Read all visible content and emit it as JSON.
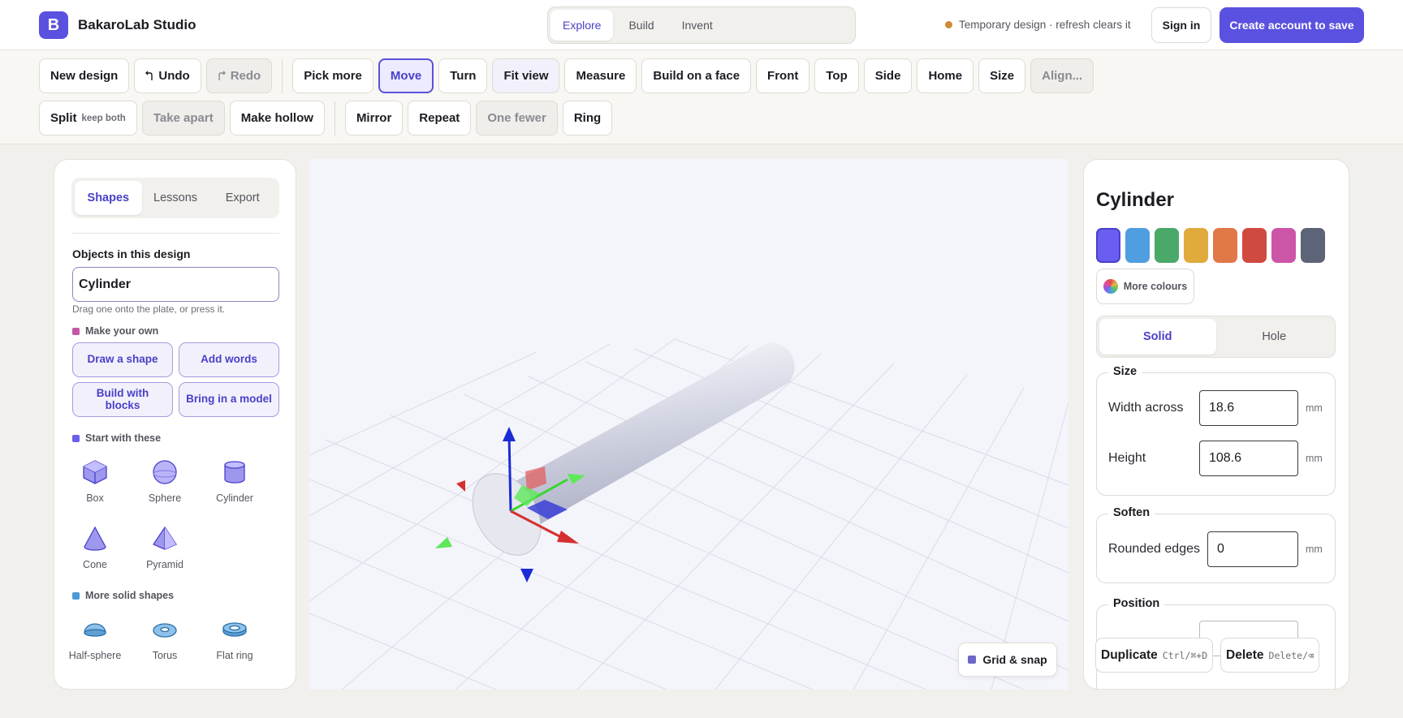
{
  "app": {
    "logo_letter": "B",
    "name": "BakaroLab Studio",
    "modes": [
      "Explore",
      "Build",
      "Invent"
    ],
    "active_mode": "Explore",
    "temp_note": "Temporary design · refresh clears it",
    "sign_in": "Sign in",
    "create_account": "Create account to save",
    "accent_color": "#5b51e0"
  },
  "toolbar": {
    "row1": [
      {
        "label": "New design"
      },
      {
        "label": "Undo",
        "icon": "undo-icon"
      },
      {
        "label": "Redo",
        "icon": "redo-icon",
        "state": "disabled"
      },
      {
        "label": "Pick more"
      },
      {
        "label": "Move",
        "state": "active"
      },
      {
        "label": "Turn"
      },
      {
        "label": "Fit view",
        "state": "soft"
      },
      {
        "label": "Measure"
      },
      {
        "label": "Build on a face"
      },
      {
        "label": "Front"
      },
      {
        "label": "Top"
      },
      {
        "label": "Side"
      },
      {
        "label": "Home"
      },
      {
        "label": "Size"
      },
      {
        "label": "Align...",
        "state": "disabled"
      }
    ],
    "row2": [
      {
        "label": "Split",
        "hint": "keep both"
      },
      {
        "label": "Take apart",
        "state": "disabled"
      },
      {
        "label": "Make hollow"
      },
      {
        "label": "Mirror"
      },
      {
        "label": "Repeat"
      },
      {
        "label": "One fewer",
        "state": "disabled"
      },
      {
        "label": "Ring"
      }
    ]
  },
  "left_panel": {
    "tabs": [
      "Shapes",
      "Lessons",
      "Export"
    ],
    "active_tab": "Shapes",
    "objects_title": "Objects in this design",
    "object_value": "Cylinder",
    "object_hint": "Drag one onto the plate, or press it.",
    "make_own_title": "Make your own",
    "make_own_buttons": [
      "Draw a shape",
      "Add words",
      "Build with blocks",
      "Bring in a model"
    ],
    "start_title": "Start with these",
    "start_shapes": [
      {
        "label": "Box",
        "icon": "box-icon"
      },
      {
        "label": "Sphere",
        "icon": "sphere-icon"
      },
      {
        "label": "Cylinder",
        "icon": "cylinder-icon"
      },
      {
        "label": "Cone",
        "icon": "cone-icon"
      },
      {
        "label": "Pyramid",
        "icon": "pyramid-icon"
      }
    ],
    "more_title": "More solid shapes",
    "more_shapes": [
      {
        "label": "Half-sphere",
        "icon": "half-sphere-icon"
      },
      {
        "label": "Torus",
        "icon": "torus-icon"
      },
      {
        "label": "Flat ring",
        "icon": "flat-ring-icon"
      }
    ],
    "colors": {
      "make_own": "#c457a4",
      "start": "#6a5ee8",
      "more": "#4b9ad8"
    }
  },
  "viewport": {
    "grid_snap": "Grid & snap"
  },
  "right_panel": {
    "title": "Cylinder",
    "swatches": [
      "#6a5ef0",
      "#4f9ee0",
      "#4aa868",
      "#e0aa3c",
      "#e07848",
      "#d04a40",
      "#cc55a8",
      "#5d6478"
    ],
    "more_colours": "More colours",
    "modes": [
      "Solid",
      "Hole"
    ],
    "active_mode": "Solid",
    "size_title": "Size",
    "width_label": "Width across",
    "width_value": "18.6",
    "height_label": "Height",
    "height_value": "108.6",
    "unit": "mm",
    "soften_title": "Soften",
    "rounded_label": "Rounded edges",
    "rounded_value": "0",
    "position_title": "Position",
    "duplicate": "Duplicate",
    "duplicate_hint": "Ctrl/⌘+D",
    "delete": "Delete",
    "delete_hint": "Delete/⌫"
  }
}
